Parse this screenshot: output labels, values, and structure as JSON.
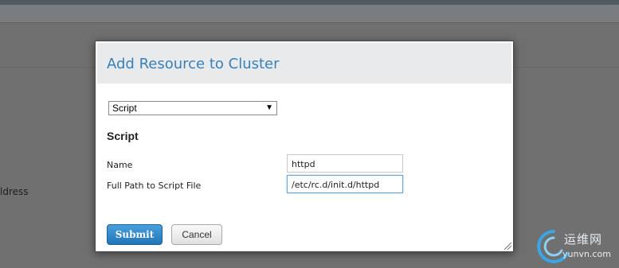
{
  "background": {
    "partial_text": "ldress"
  },
  "dialog": {
    "title": "Add Resource to Cluster",
    "resource_type": {
      "selected": "Script"
    },
    "section_title": "Script",
    "fields": [
      {
        "label": "Name",
        "value": "httpd"
      },
      {
        "label": "Full Path to Script File",
        "value": "/etc/rc.d/init.d/httpd"
      }
    ],
    "submit_label": "Submit",
    "cancel_label": "Cancel"
  },
  "watermark": {
    "site_name": "运维网",
    "url": "yunvn.com"
  },
  "colors": {
    "title": "#3880b8",
    "submit_button": "#1f75b8",
    "focus_border": "#6aa6d6"
  }
}
